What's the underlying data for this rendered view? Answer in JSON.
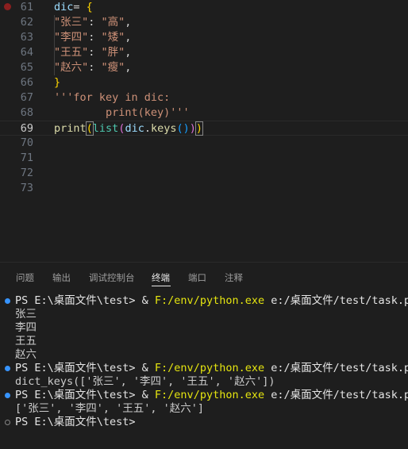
{
  "editor": {
    "lines": [
      {
        "num": "61",
        "parts": [
          {
            "t": "dic",
            "c": "k-var"
          },
          {
            "t": "= ",
            "c": "k-op"
          },
          {
            "t": "{",
            "c": "k-br1"
          }
        ]
      },
      {
        "num": "62",
        "parts": [
          {
            "t": "\"张三\"",
            "c": "k-str"
          },
          {
            "t": ": ",
            "c": "k-op"
          },
          {
            "t": "\"高\"",
            "c": "k-str"
          },
          {
            "t": ",",
            "c": "k-op"
          }
        ]
      },
      {
        "num": "63",
        "parts": [
          {
            "t": "\"李四\"",
            "c": "k-str"
          },
          {
            "t": ": ",
            "c": "k-op"
          },
          {
            "t": "\"矮\"",
            "c": "k-str"
          },
          {
            "t": ",",
            "c": "k-op"
          }
        ]
      },
      {
        "num": "64",
        "parts": [
          {
            "t": "\"王五\"",
            "c": "k-str"
          },
          {
            "t": ": ",
            "c": "k-op"
          },
          {
            "t": "\"胖\"",
            "c": "k-str"
          },
          {
            "t": ",",
            "c": "k-op"
          }
        ]
      },
      {
        "num": "65",
        "parts": [
          {
            "t": "\"赵六\"",
            "c": "k-str"
          },
          {
            "t": ": ",
            "c": "k-op"
          },
          {
            "t": "\"瘦\"",
            "c": "k-str"
          },
          {
            "t": ",",
            "c": "k-op"
          }
        ]
      },
      {
        "num": "66",
        "parts": [
          {
            "t": "}",
            "c": "k-br1"
          }
        ]
      },
      {
        "num": "67",
        "parts": [
          {
            "t": "'''for key in dic:",
            "c": "k-str"
          }
        ]
      },
      {
        "num": "68",
        "parts": [
          {
            "t": "        print(key)'''",
            "c": "k-str"
          }
        ]
      },
      {
        "num": "69",
        "parts": [
          {
            "t": "print",
            "c": "k-fn"
          },
          {
            "t": "(",
            "c": "k-br1 bracket-box"
          },
          {
            "t": "list",
            "c": "k-cls"
          },
          {
            "t": "(",
            "c": "k-br2"
          },
          {
            "t": "dic",
            "c": "k-var"
          },
          {
            "t": ".",
            "c": "k-op"
          },
          {
            "t": "keys",
            "c": "k-fn"
          },
          {
            "t": "()",
            "c": "k-br3"
          },
          {
            "t": ")",
            "c": "k-br2"
          },
          {
            "t": ")",
            "c": "k-br1 bracket-box"
          }
        ]
      },
      {
        "num": "70",
        "parts": []
      },
      {
        "num": "71",
        "parts": []
      },
      {
        "num": "72",
        "parts": []
      },
      {
        "num": "73",
        "parts": []
      }
    ]
  },
  "panel": {
    "tabs": [
      {
        "label": "问题"
      },
      {
        "label": "输出"
      },
      {
        "label": "调试控制台"
      },
      {
        "label": "终端"
      },
      {
        "label": "端口"
      },
      {
        "label": "注释"
      }
    ],
    "active_tab": "终端"
  },
  "terminal": {
    "lines": [
      {
        "dot": "blue",
        "parts": [
          {
            "t": "PS E:\\桌面文件\\test> & ",
            "c": "t-white"
          },
          {
            "t": "F:/env/python.exe",
            "c": "t-yellow"
          },
          {
            "t": " e:/桌面文件/test/task.py",
            "c": "t-white"
          }
        ]
      },
      {
        "dot": "",
        "parts": [
          {
            "t": "张三",
            "c": ""
          }
        ]
      },
      {
        "dot": "",
        "parts": [
          {
            "t": "李四",
            "c": ""
          }
        ]
      },
      {
        "dot": "",
        "parts": [
          {
            "t": "王五",
            "c": ""
          }
        ]
      },
      {
        "dot": "",
        "parts": [
          {
            "t": "赵六",
            "c": ""
          }
        ]
      },
      {
        "dot": "blue",
        "parts": [
          {
            "t": "PS E:\\桌面文件\\test> & ",
            "c": "t-white"
          },
          {
            "t": "F:/env/python.exe",
            "c": "t-yellow"
          },
          {
            "t": " e:/桌面文件/test/task.py",
            "c": "t-white"
          }
        ]
      },
      {
        "dot": "",
        "parts": [
          {
            "t": "dict_keys(['张三', '李四', '王五', '赵六'])",
            "c": ""
          }
        ]
      },
      {
        "dot": "blue",
        "parts": [
          {
            "t": "PS E:\\桌面文件\\test> & ",
            "c": "t-white"
          },
          {
            "t": "F:/env/python.exe",
            "c": "t-yellow"
          },
          {
            "t": " e:/桌面文件/test/task.py",
            "c": "t-white"
          }
        ]
      },
      {
        "dot": "",
        "parts": [
          {
            "t": "['张三', '李四', '王五', '赵六']",
            "c": ""
          }
        ]
      },
      {
        "dot": "hollow",
        "parts": [
          {
            "t": "PS E:\\桌面文件\\test>",
            "c": "t-white"
          }
        ]
      }
    ]
  },
  "colors": {
    "background": "#1e1e1e",
    "terminal_accent": "#3794ff",
    "breakpoint": "#8b1f1f"
  }
}
